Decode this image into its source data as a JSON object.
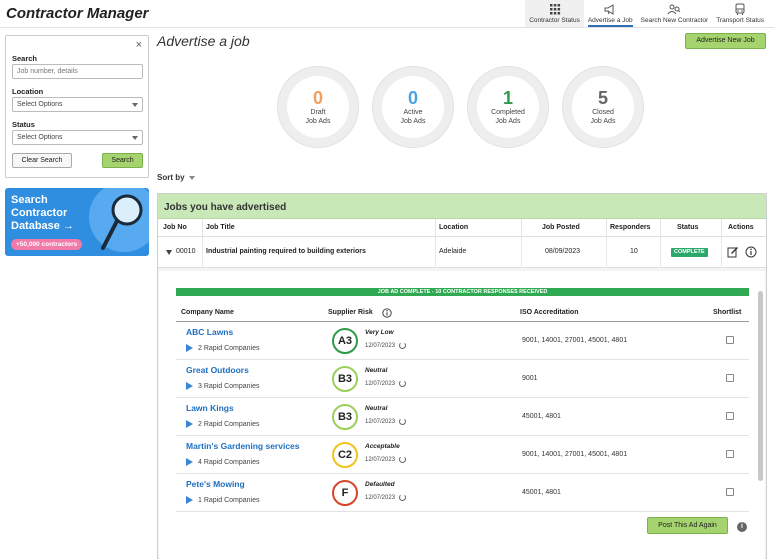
{
  "app": {
    "title": "Contractor Manager"
  },
  "topnav": [
    {
      "label": "Contractor Status",
      "icon": "grid-icon"
    },
    {
      "label": "Advertise a Job",
      "icon": "megaphone-icon"
    },
    {
      "label": "Search New Contractor",
      "icon": "people-search-icon"
    },
    {
      "label": "Transport Status",
      "icon": "bus-icon"
    }
  ],
  "filters": {
    "search_label": "Search",
    "search_placeholder": "Job number, details",
    "location_label": "Location",
    "location_value": "Select Options",
    "status_label": "Status",
    "status_value": "Select Options",
    "clear_label": "Clear Search",
    "search_button": "Search",
    "close": "×"
  },
  "promo": {
    "title": "Search Contractor Database →",
    "badge": "+50,000 contractors"
  },
  "page": {
    "title": "Advertise a job",
    "advertise_button": "Advertise New Job",
    "sort_label": "Sort by"
  },
  "stats": [
    {
      "value": "0",
      "line1": "Draft",
      "line2": "Job Ads",
      "color": "#f2a060"
    },
    {
      "value": "0",
      "line1": "Active",
      "line2": "Job Ads",
      "color": "#4ba3e3"
    },
    {
      "value": "1",
      "line1": "Completed",
      "line2": "Job Ads",
      "color": "#2e9a4a"
    },
    {
      "value": "5",
      "line1": "Closed",
      "line2": "Job Ads",
      "color": "#666666"
    }
  ],
  "jobs": {
    "heading": "Jobs you have advertised",
    "columns": [
      "Job No",
      "Job Title",
      "Location",
      "Job Posted",
      "Responders",
      "Status",
      "Actions"
    ],
    "row": {
      "job_no": "00010",
      "title": "Industrial painting required to building exteriors",
      "location": "Adelaide",
      "posted": "08/09/2023",
      "responders": "10",
      "status": "COMPLETE"
    }
  },
  "detail": {
    "banner": "JOB AD COMPLETE - 10 CONTRACTOR RESPONSES RECEIVED",
    "columns": [
      "Company Name",
      "Supplier Risk",
      "ISO Accreditation",
      "Shortlist"
    ],
    "companies": [
      {
        "name": "ABC Lawns",
        "rapid": "2 Rapid Companies",
        "grade": "A3",
        "risk": "Very Low",
        "date": "12/07/2023",
        "iso": "9001, 14001, 27001, 45001, 4801",
        "grade_color": "#2e9a4a"
      },
      {
        "name": "Great Outdoors",
        "rapid": "3 Rapid Companies",
        "grade": "B3",
        "risk": "Neutral",
        "date": "12/07/2023",
        "iso": "9001",
        "grade_color": "#9ccf5a"
      },
      {
        "name": "Lawn Kings",
        "rapid": "2 Rapid Companies",
        "grade": "B3",
        "risk": "Neutral",
        "date": "12/07/2023",
        "iso": "45001, 4801",
        "grade_color": "#9ccf5a"
      },
      {
        "name": "Martin's Gardening services",
        "rapid": "4 Rapid Companies",
        "grade": "C2",
        "risk": "Acceptable",
        "date": "12/07/2023",
        "iso": "9001, 14001, 27001, 45001, 4801",
        "grade_color": "#f0c419"
      },
      {
        "name": "Pete's Mowing",
        "rapid": "1 Rapid Companies",
        "grade": "F",
        "risk": "Defaulted",
        "date": "12/07/2023",
        "iso": "45001, 4801",
        "grade_color": "#d9442b"
      }
    ],
    "post_again": "Post This Ad Again"
  }
}
